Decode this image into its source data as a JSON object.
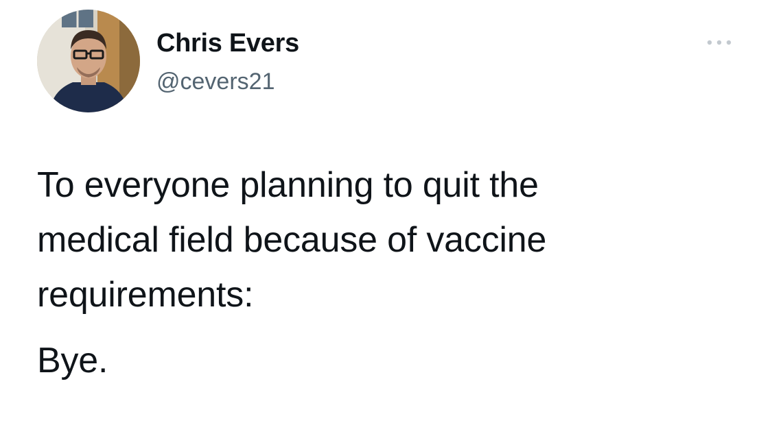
{
  "tweet": {
    "author": {
      "display_name": "Chris Evers",
      "handle": "@cevers21",
      "avatar_icon": "profile-photo"
    },
    "more_icon": "more-horizontal-icon",
    "text_lines": [
      "To everyone planning to quit the",
      "medical field because of vaccine",
      "requirements:"
    ],
    "closing": "Bye."
  },
  "colors": {
    "text": "#0f1419",
    "secondary": "#536471",
    "background": "#ffffff"
  }
}
